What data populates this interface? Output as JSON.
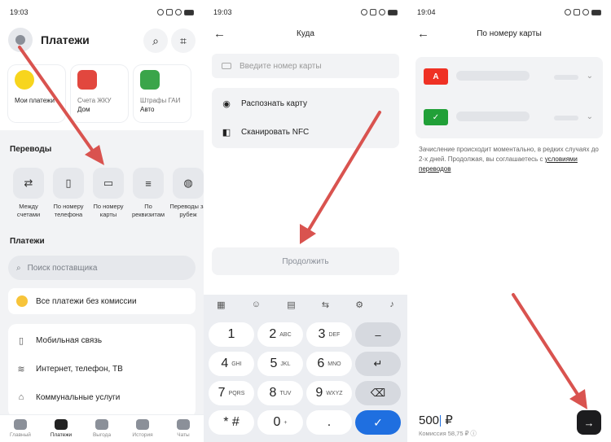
{
  "screen1": {
    "time": "19:03",
    "title": "Платежи",
    "tiles": [
      {
        "line1": "",
        "line2": "Мои платежи",
        "color": "#f7d51d"
      },
      {
        "line1": "Счета ЖКУ",
        "line2": "Дом",
        "color": "#e2473e"
      },
      {
        "line1": "Штрафы ГАИ",
        "line2": "Авто",
        "color": "#3aa54a"
      }
    ],
    "transfers_title": "Переводы",
    "transfers": [
      {
        "label": "Между счетами",
        "icon": "⇄"
      },
      {
        "label": "По номеру телефона",
        "icon": "▯"
      },
      {
        "label": "По номеру карты",
        "icon": "▭"
      },
      {
        "label": "По реквизитам",
        "icon": "≡"
      },
      {
        "label": "Переводы за рубеж",
        "icon": "◍"
      }
    ],
    "payments_title": "Платежи",
    "search_placeholder": "Поиск поставщика",
    "no_commission": "Все платежи без комиссии",
    "categories": [
      {
        "label": "Мобильная связь",
        "icon": "▯"
      },
      {
        "label": "Интернет, телефон, ТВ",
        "icon": "≋"
      },
      {
        "label": "Коммунальные услуги",
        "icon": "⌂"
      }
    ],
    "tabs": [
      {
        "label": "Главный",
        "active": false
      },
      {
        "label": "Платежи",
        "active": true
      },
      {
        "label": "Выгода",
        "active": false
      },
      {
        "label": "История",
        "active": false
      },
      {
        "label": "Чаты",
        "active": false
      }
    ]
  },
  "screen2": {
    "time": "19:03",
    "title": "Куда",
    "card_placeholder": "Введите номер карты",
    "options": [
      {
        "label": "Распознать карту",
        "icon": "◉"
      },
      {
        "label": "Сканировать NFC",
        "icon": "◧"
      }
    ],
    "continue": "Продолжить",
    "keys": [
      {
        "main": "1",
        "sub": ""
      },
      {
        "main": "2",
        "sub": "ABC"
      },
      {
        "main": "3",
        "sub": "DEF"
      },
      {
        "main": "–",
        "sub": ""
      },
      {
        "main": "4",
        "sub": "GHI"
      },
      {
        "main": "5",
        "sub": "JKL"
      },
      {
        "main": "6",
        "sub": "MNO"
      },
      {
        "main": "↵",
        "sub": ""
      },
      {
        "main": "7",
        "sub": "PQRS"
      },
      {
        "main": "8",
        "sub": "TUV"
      },
      {
        "main": "9",
        "sub": "WXYZ"
      },
      {
        "main": "⌫",
        "sub": ""
      },
      {
        "main": "* #",
        "sub": ""
      },
      {
        "main": "0",
        "sub": "+"
      },
      {
        "main": ".",
        "sub": ""
      },
      {
        "main": "✓",
        "sub": ""
      }
    ]
  },
  "screen3": {
    "time": "19:04",
    "title": "По номеру карты",
    "banks": [
      {
        "letter": "А",
        "color": "#ef3124"
      },
      {
        "letter": "✓",
        "color": "#21a038"
      }
    ],
    "info_text": "Зачисление происходит моментально, в редких случаях до 2-х дней. Продолжая, вы соглашаетесь с ",
    "info_link": "условиями переводов",
    "amount": "500",
    "currency": "₽",
    "commission": "Комиссия 58,75 ₽ ⓘ",
    "next_icon": "→"
  },
  "colors": {
    "accent": "#1f6fe0",
    "arrow": "#d9534f"
  }
}
